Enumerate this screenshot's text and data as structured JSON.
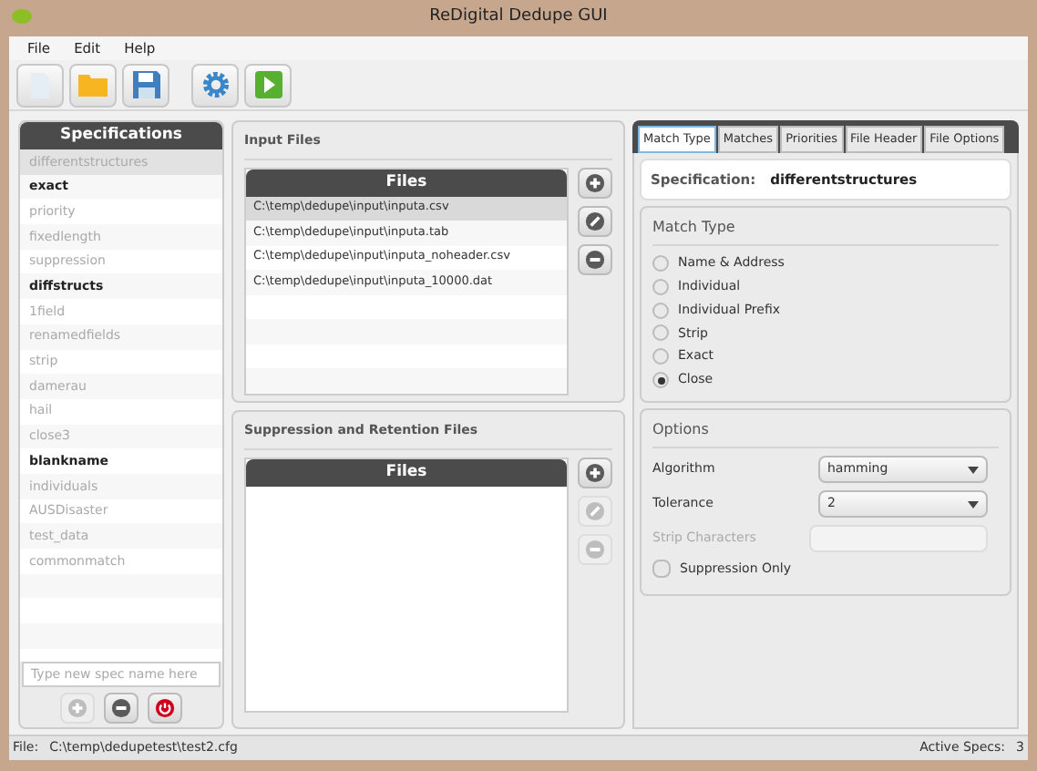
{
  "window": {
    "title": "ReDigital Dedupe GUI"
  },
  "menu": [
    "File",
    "Edit",
    "Help"
  ],
  "specifications": {
    "title": "Specifications",
    "items": [
      {
        "name": "differentstructures",
        "active": false,
        "selected": true
      },
      {
        "name": "exact",
        "active": true,
        "selected": false
      },
      {
        "name": "priority",
        "active": false,
        "selected": false
      },
      {
        "name": "fixedlength",
        "active": false,
        "selected": false
      },
      {
        "name": "suppression",
        "active": false,
        "selected": false
      },
      {
        "name": "diffstructs",
        "active": true,
        "selected": false
      },
      {
        "name": "1field",
        "active": false,
        "selected": false
      },
      {
        "name": "renamedfields",
        "active": false,
        "selected": false
      },
      {
        "name": "strip",
        "active": false,
        "selected": false
      },
      {
        "name": "damerau",
        "active": false,
        "selected": false
      },
      {
        "name": "hail",
        "active": false,
        "selected": false
      },
      {
        "name": "close3",
        "active": false,
        "selected": false
      },
      {
        "name": "blankname",
        "active": true,
        "selected": false
      },
      {
        "name": "individuals",
        "active": false,
        "selected": false
      },
      {
        "name": "AUSDisaster",
        "active": false,
        "selected": false
      },
      {
        "name": "test_data",
        "active": false,
        "selected": false
      },
      {
        "name": "commonmatch",
        "active": false,
        "selected": false
      }
    ],
    "new_placeholder": "Type new spec name here",
    "buttons": [
      {
        "kind": "add",
        "disabled": true
      },
      {
        "kind": "remove",
        "disabled": false
      },
      {
        "kind": "delete",
        "disabled": false
      }
    ]
  },
  "input_files": {
    "title": "Input Files",
    "column": "Files",
    "rows": [
      {
        "path": "C:\\temp\\dedupe\\input\\inputa.csv",
        "selected": true
      },
      {
        "path": "C:\\temp\\dedupe\\input\\inputa.tab",
        "selected": false
      },
      {
        "path": "C:\\temp\\dedupe\\input\\inputa_noheader.csv",
        "selected": false
      },
      {
        "path": "C:\\temp\\dedupe\\input\\inputa_10000.dat",
        "selected": false
      }
    ],
    "buttons": [
      {
        "kind": "add",
        "disabled": false
      },
      {
        "kind": "edit",
        "disabled": false
      },
      {
        "kind": "remove",
        "disabled": false
      }
    ]
  },
  "suppression_files": {
    "title": "Suppression and Retention Files",
    "column": "Files",
    "buttons": [
      {
        "kind": "add",
        "disabled": false
      },
      {
        "kind": "edit",
        "disabled": true
      },
      {
        "kind": "remove",
        "disabled": true
      }
    ]
  },
  "tabs": [
    {
      "label": "Match Type",
      "selected": true
    },
    {
      "label": "Matches",
      "selected": false
    },
    {
      "label": "Priorities",
      "selected": false
    },
    {
      "label": "File Header",
      "selected": false
    },
    {
      "label": "File Options",
      "selected": false
    }
  ],
  "specification": {
    "label": "Specification:",
    "value": "differentstructures"
  },
  "match_type": {
    "title": "Match Type",
    "options": [
      {
        "label": "Name & Address",
        "selected": false
      },
      {
        "label": "Individual",
        "selected": false
      },
      {
        "label": "Individual Prefix",
        "selected": false
      },
      {
        "label": "Strip",
        "selected": false
      },
      {
        "label": "Exact",
        "selected": false
      },
      {
        "label": "Close",
        "selected": true
      }
    ]
  },
  "options": {
    "title": "Options",
    "algorithm": {
      "label": "Algorithm",
      "value": "hamming"
    },
    "tolerance": {
      "label": "Tolerance",
      "value": "2"
    },
    "strip_characters": {
      "label": "Strip Characters",
      "disabled": true
    },
    "suppression_only": {
      "label": "Suppression Only",
      "checked": false
    }
  },
  "status_bar": {
    "file_label": "File:",
    "file": "C:\\temp\\dedupetest\\test2.cfg",
    "active_label": "Active Specs:",
    "active": "3"
  }
}
